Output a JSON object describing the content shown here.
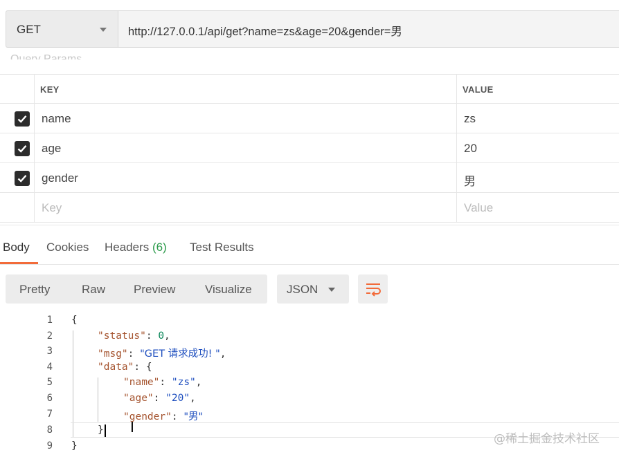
{
  "request": {
    "method": "GET",
    "url": "http://127.0.0.1/api/get?name=zs&age=20&gender=男",
    "section_title": "Query Params"
  },
  "params": {
    "header": {
      "key": "KEY",
      "value": "VALUE"
    },
    "rows": [
      {
        "checked": true,
        "key": "name",
        "value": "zs"
      },
      {
        "checked": true,
        "key": "age",
        "value": "20"
      },
      {
        "checked": true,
        "key": "gender",
        "value": "男"
      }
    ],
    "placeholder": {
      "key": "Key",
      "value": "Value"
    }
  },
  "response_tabs": {
    "body": "Body",
    "cookies": "Cookies",
    "headers": "Headers",
    "headers_count": "(6)",
    "test_results": "Test Results",
    "active": "Body"
  },
  "view_modes": {
    "pretty": "Pretty",
    "raw": "Raw",
    "preview": "Preview",
    "visualize": "Visualize",
    "format": "JSON",
    "wrap_icon": "wrap-lines-icon"
  },
  "code": {
    "line_numbers": [
      "1",
      "2",
      "3",
      "4",
      "5",
      "6",
      "7",
      "8",
      "9"
    ],
    "status_key": "\"status\"",
    "status_val": "0",
    "msg_key": "\"msg\"",
    "msg_val": "\"GET 请求成功! \"",
    "data_key": "\"data\"",
    "name_key": "\"name\"",
    "name_val": "\"zs\"",
    "age_key": "\"age\"",
    "age_val": "\"20\"",
    "gender_key": "\"gender\"",
    "gender_val": "\"男\""
  },
  "watermark": "@稀土掘金技术社区",
  "colors": {
    "accent": "#f26b3a",
    "json_key": "#a5542f",
    "json_string": "#1f4fbf",
    "json_number": "#098658",
    "headers_count": "#2b9a4a"
  }
}
